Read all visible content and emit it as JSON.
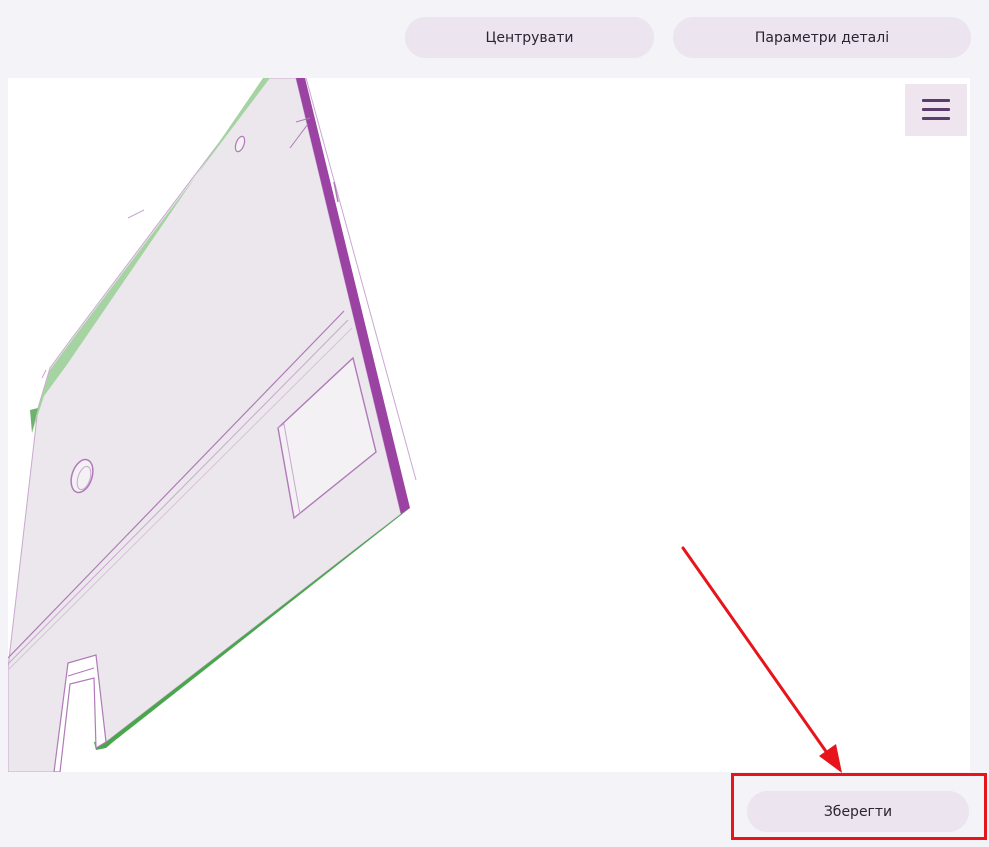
{
  "toolbar": {
    "center_label": "Центрувати",
    "params_label": "Параметри деталі"
  },
  "viewer": {
    "menu_icon": "hamburger-menu-icon",
    "model_colors": {
      "face": "#ebe7ec",
      "edge_green": "#4aa64c",
      "edge_light_green": "#a6d3a2",
      "edge_purple": "#9a43a3",
      "line": "#b07ab8"
    }
  },
  "footer": {
    "save_label": "Зберегти"
  },
  "annotation": {
    "color": "#e8141b"
  }
}
